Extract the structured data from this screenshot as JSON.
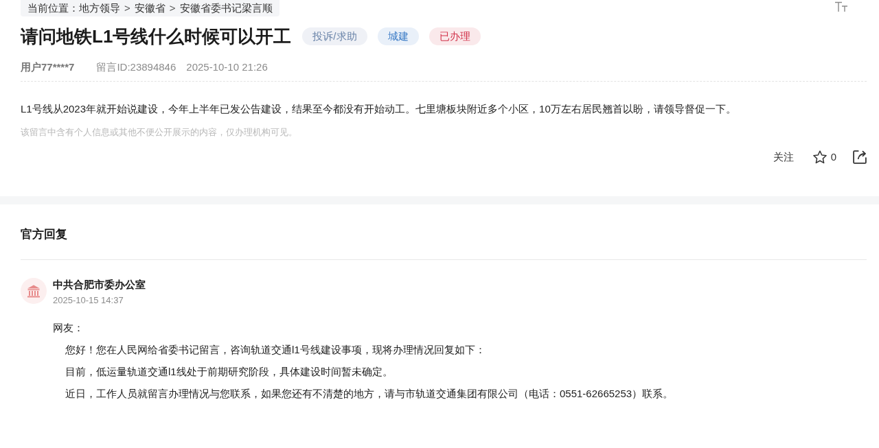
{
  "breadcrumb": {
    "label": "当前位置：",
    "items": [
      {
        "kind": "link",
        "text": "地方领导"
      },
      {
        "kind": "separator",
        "text": ">"
      },
      {
        "kind": "link",
        "text": "安徽省"
      },
      {
        "kind": "separator",
        "text": ">"
      },
      {
        "kind": "link",
        "text": "安徽省委书记梁言顺"
      }
    ]
  },
  "message": {
    "title": "请问地铁L1号线什么时候可以开工",
    "tags": [
      {
        "text": "投诉/求助",
        "color": "#6a84a9"
      },
      {
        "text": "城建",
        "color": "#3b7bc6"
      },
      {
        "text": "已办理",
        "color": "#d2344c"
      }
    ],
    "author": "用户77****7",
    "message_id": "留言ID:23894846",
    "time": "2025-10-10 21:26",
    "content": "L1号线从2023年就开始说建设，今年上半年已发公告建设，结果至今都没有开始动工。七里塘板块附近多个小区，10万左右居民翘首以盼，请领导督促一下。",
    "privacy_notice": "该留言中含有个人信息或其他不便公开展示的内容，仅办理机构可见。",
    "actions": {
      "follow": "关注",
      "favorite_count": "0",
      "favorited": false
    }
  },
  "official_reply": {
    "heading": "官方回复",
    "org": "中共合肥市委办公室",
    "time": "2025-10-15 14:37",
    "salutation": "网友：",
    "paragraphs": [
      "您好！您在人民网给省委书记留言，咨询轨道交通l1号线建设事项，现将办理情况回复如下：",
      "目前，低运量轨道交通l1线处于前期研究阶段，具体建设时间暂未确定。",
      "近日，工作人员就留言办理情况与您联系，如果您还有不清楚的地方，请与市轨道交通集团有限公司（电话：0551-62665253）联系。"
    ]
  }
}
